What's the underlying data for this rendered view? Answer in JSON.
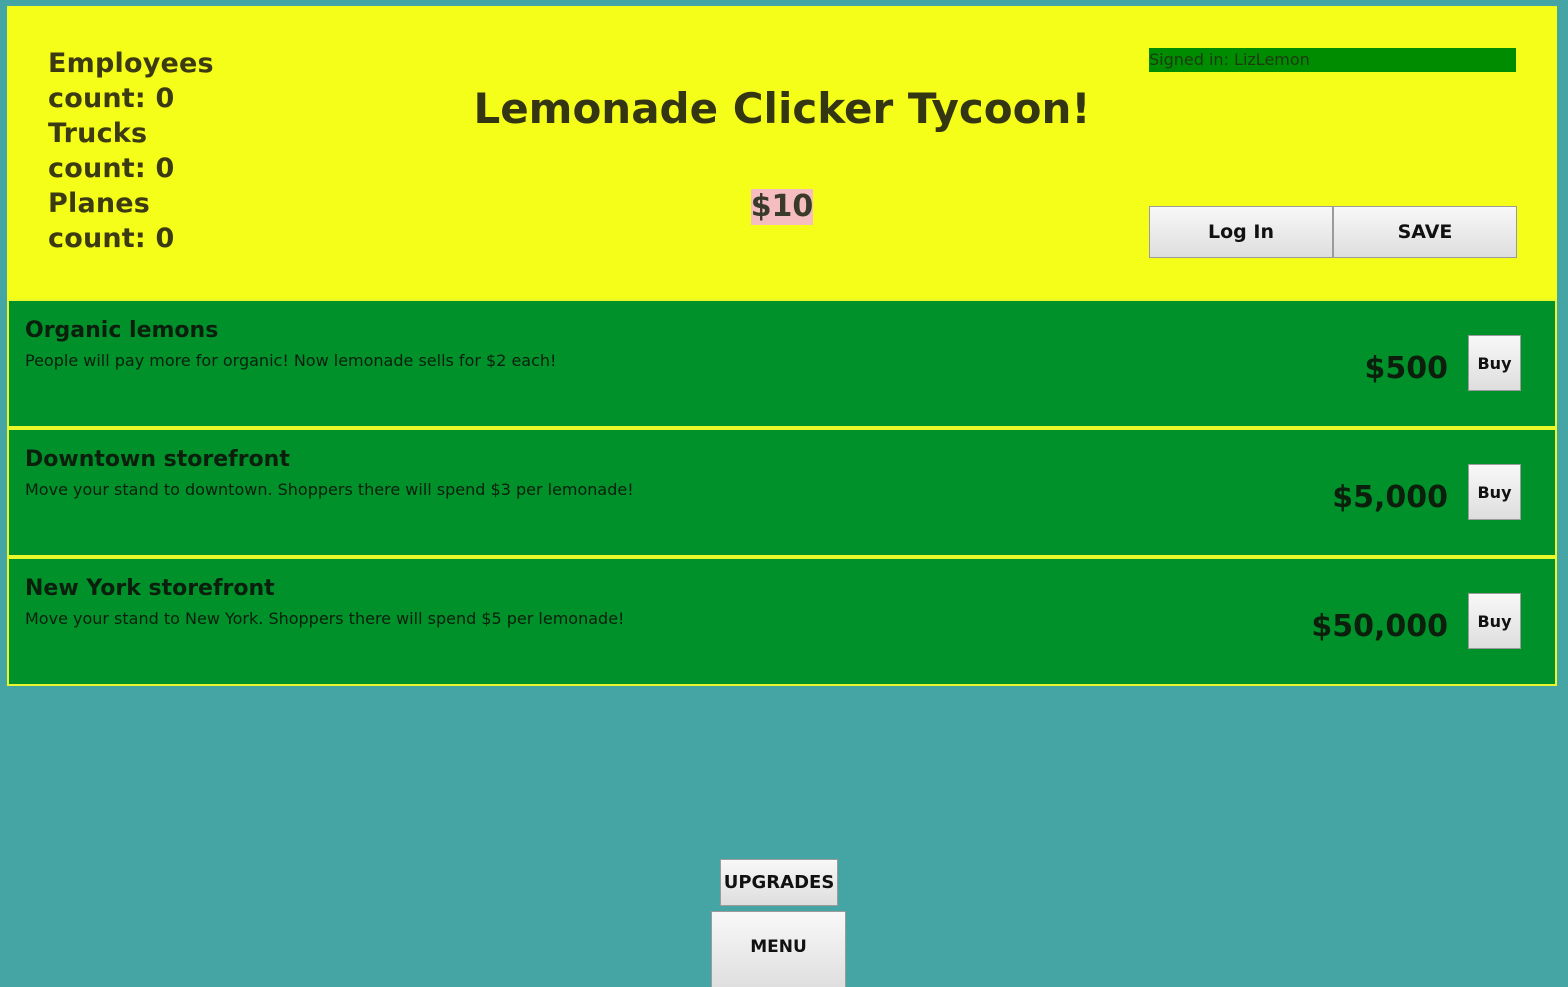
{
  "header": {
    "title": "Lemonade Clicker Tycoon!",
    "money": "$10",
    "signed_in": "Signed in: LizLemon",
    "login_label": "Log In",
    "save_label": "SAVE"
  },
  "stats": [
    {
      "name": "Employees",
      "count_text": "count: 0"
    },
    {
      "name": "Trucks",
      "count_text": "count: 0"
    },
    {
      "name": "Planes",
      "count_text": "count: 0"
    }
  ],
  "upgrades": [
    {
      "name": "Organic lemons",
      "description": "People will pay more for organic! Now lemonade sells for $2 each!",
      "price": "$500",
      "buy_label": "Buy"
    },
    {
      "name": "Downtown storefront",
      "description": "Move your stand to downtown. Shoppers there will spend $3 per lemonade!",
      "price": "$5,000",
      "buy_label": "Buy"
    },
    {
      "name": "New York storefront",
      "description": "Move your stand to New York. Shoppers there will spend $5 per lemonade!",
      "price": "$50,000",
      "buy_label": "Buy"
    }
  ],
  "nav": {
    "upgrades_label": "UPGRADES",
    "menu_label": "MENU"
  },
  "colors": {
    "page_background": "#45a5a4",
    "header_background": "#f4fe19",
    "upgrade_background": "#00912b",
    "upgrade_border": "#e8f82a",
    "signed_in_background": "#008c00",
    "money_highlight": "#f5bdbf"
  }
}
